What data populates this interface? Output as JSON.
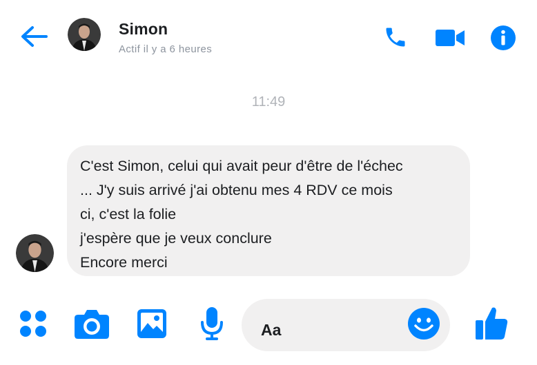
{
  "header": {
    "contact_name": "Simon",
    "contact_status": "Actif il y a 6 heures",
    "icons": {
      "back": "arrow-left-icon",
      "call": "phone-icon",
      "video": "video-camera-icon",
      "info": "info-icon"
    }
  },
  "conversation": {
    "timestamp": "11:49",
    "messages": [
      {
        "sender": "Simon",
        "lines": [
          "C'est Simon, celui qui avait peur d'être de l'échec",
          "... J'y suis arrivé j'ai obtenu mes 4 RDV ce mois",
          "ci, c'est la folie",
          "j'espère que je veux conclure",
          "Encore merci"
        ]
      }
    ]
  },
  "composer": {
    "placeholder": "Aa",
    "icons": {
      "more": "more-apps-icon",
      "camera": "camera-icon",
      "gallery": "image-icon",
      "mic": "microphone-icon",
      "emoji": "smiley-icon",
      "like": "thumbs-up-icon"
    }
  },
  "colors": {
    "accent": "#0084ff",
    "bubble": "#f1f0f0",
    "muted_text": "#8d949e",
    "timestamp": "#b0b3b8"
  }
}
